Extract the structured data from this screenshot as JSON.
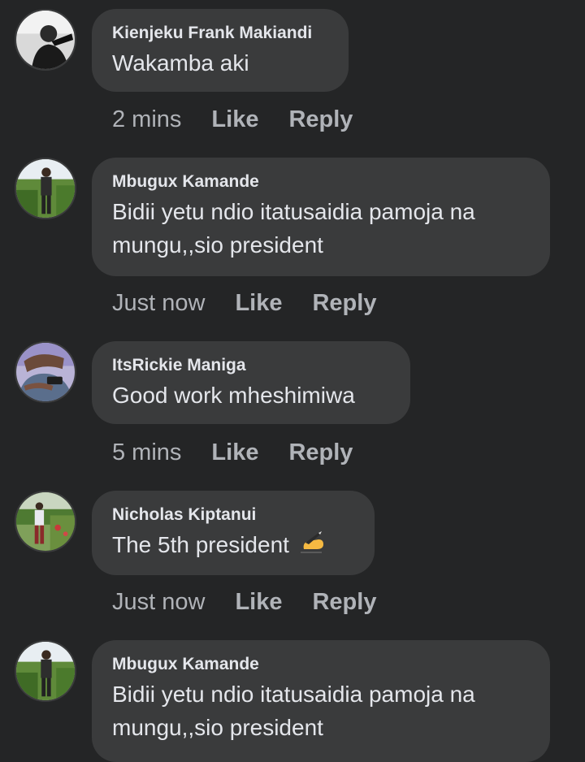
{
  "comments": [
    {
      "author": "Kienjeku Frank Makiandi",
      "text": "Wakamba aki",
      "time": "2 mins",
      "like": "Like",
      "reply": "Reply",
      "avatar_icon": "avatar-photo"
    },
    {
      "author": "Mbugux Kamande",
      "text": "Bidii yetu ndio itatusaidia pamoja na mungu,,sio president",
      "time": "Just now",
      "like": "Like",
      "reply": "Reply",
      "avatar_icon": "avatar-photo"
    },
    {
      "author": "ItsRickie Maniga",
      "text": "Good work mheshimiwa",
      "time": "5 mins",
      "like": "Like",
      "reply": "Reply",
      "avatar_icon": "avatar-photo"
    },
    {
      "author": "Nicholas Kiptanui",
      "text": "The 5th president",
      "emoji": "writing-hand-icon",
      "time": "Just now",
      "like": "Like",
      "reply": "Reply",
      "avatar_icon": "avatar-photo"
    },
    {
      "author": "Mbugux Kamande",
      "text": "Bidii yetu ndio itatusaidia pamoja na mungu,,sio president",
      "avatar_icon": "avatar-photo"
    }
  ],
  "colors": {
    "background": "#242526",
    "bubble": "#3a3b3c",
    "primary_text": "#e4e6eb",
    "secondary_text": "#b0b3b8"
  }
}
